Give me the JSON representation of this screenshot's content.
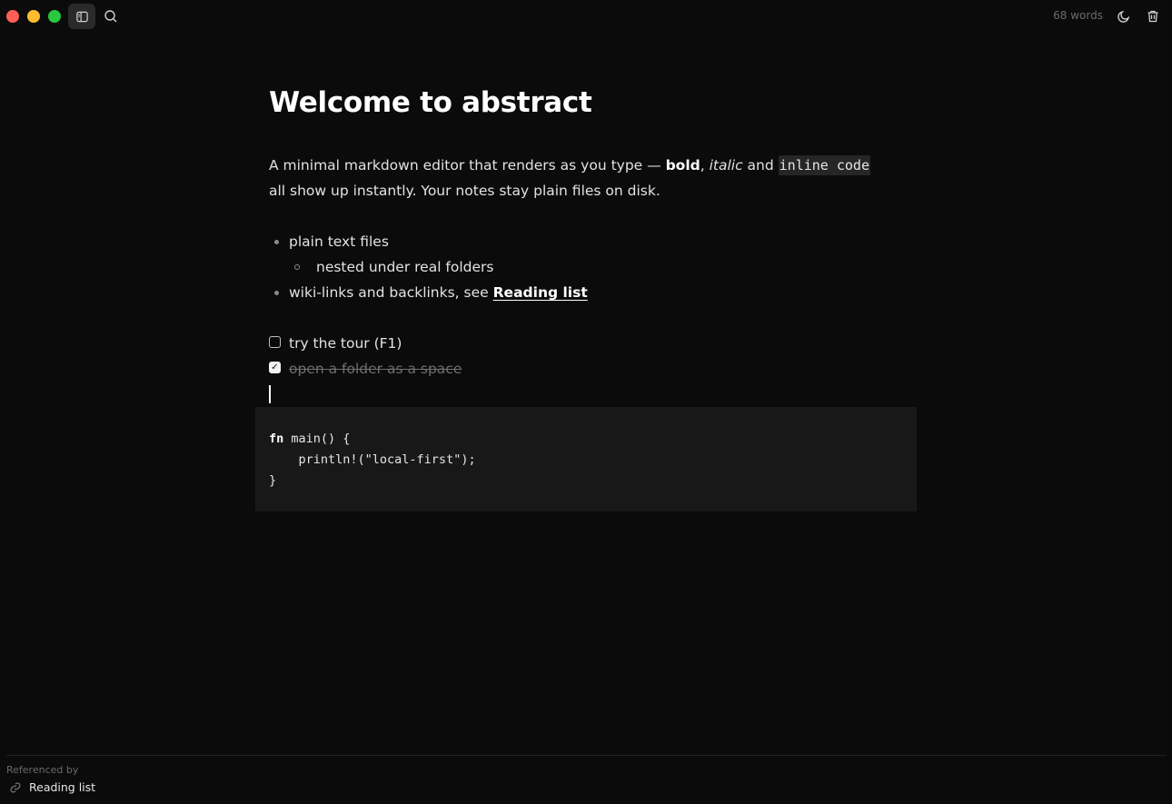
{
  "toolbar": {
    "word_count": "68 words",
    "colors": {
      "close": "#ff5f57",
      "minimize": "#febc2e",
      "maximize": "#28c840"
    }
  },
  "document": {
    "title": "Welcome to abstract",
    "intro": {
      "before": "A minimal markdown editor that renders as you type — ",
      "bold": "bold",
      "sep1": ", ",
      "italic": "italic",
      "sep2": " and ",
      "code": "inline code",
      "after": " all show up instantly. Your notes stay plain files on disk."
    },
    "list": [
      {
        "text": "plain text files"
      },
      {
        "text": "nested under real folders"
      },
      {
        "text": "wiki-links and backlinks, see ",
        "link": "Reading list"
      }
    ],
    "tasks": [
      {
        "text": "try the tour (F1)",
        "checked": false
      },
      {
        "text": "open a folder as a space",
        "checked": true
      }
    ],
    "code": {
      "line1_kw": "fn",
      "line1_rest": " main() {",
      "line2": "    println!(\"local-first\");",
      "line3": "}"
    }
  },
  "footer": {
    "label": "Referenced by",
    "items": [
      {
        "label": "Reading list",
        "icon": "link-icon"
      }
    ]
  }
}
